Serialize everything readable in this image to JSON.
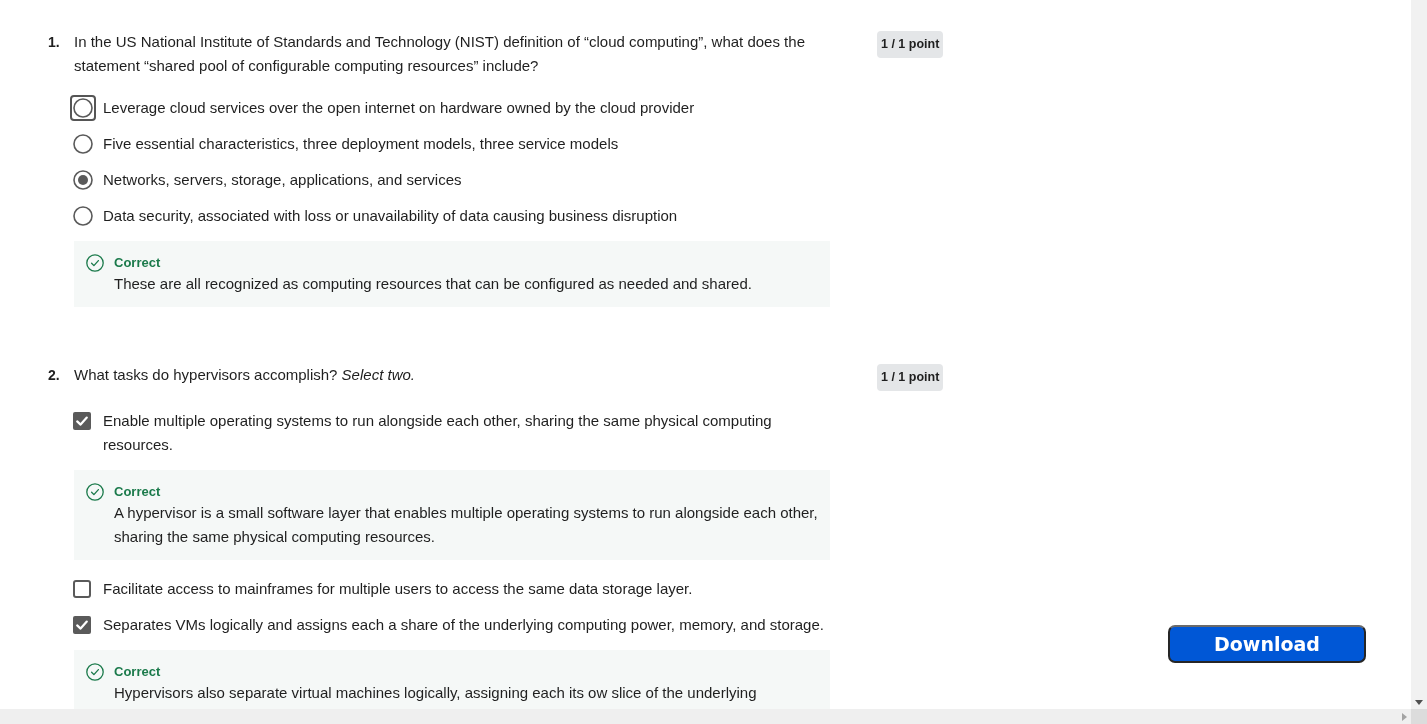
{
  "questions": [
    {
      "number": "1.",
      "prompt": "In the US National Institute of Standards and Technology (NIST) definition of “cloud computing”, what does the statement “shared pool of configurable computing resources” include?",
      "score": "1 / 1 point",
      "kind": "radio",
      "body": [
        {
          "kind": "option",
          "label": "Leverage cloud services over the open internet on hardware owned by the cloud provider",
          "selected": false,
          "focused": true
        },
        {
          "kind": "option",
          "label": "Five essential characteristics, three deployment models, three service models",
          "selected": false,
          "focused": false
        },
        {
          "kind": "option",
          "label": "Networks, servers, storage, applications, and services",
          "selected": true,
          "focused": false
        },
        {
          "kind": "option",
          "label": "Data security, associated with loss or unavailability of data causing business disruption",
          "selected": false,
          "focused": false
        },
        {
          "kind": "feedback",
          "status": "Correct",
          "text": "These are all recognized as computing resources that can be configured as needed and shared."
        }
      ]
    },
    {
      "number": "2.",
      "prompt": "What tasks do hypervisors accomplish? *Select two.*",
      "score": "1 / 1 point",
      "kind": "checkbox",
      "body": [
        {
          "kind": "option",
          "label": "Enable multiple operating systems to run alongside each other, sharing the same physical computing resources.",
          "checked": true,
          "focused": false
        },
        {
          "kind": "feedback",
          "status": "Correct",
          "text": "A hypervisor is a small software layer that enables multiple operating systems to run alongside each other, sharing the same physical computing resources."
        },
        {
          "kind": "option",
          "label": "Facilitate access to mainframes for multiple users to access the same data storage layer.",
          "checked": false,
          "focused": false
        },
        {
          "kind": "option",
          "label": "Separates VMs logically and assigns each a share of the underlying computing power, memory, and storage.",
          "checked": true,
          "focused": false
        },
        {
          "kind": "feedback",
          "status": "Correct",
          "text": "Hypervisors also separate virtual machines logically, assigning each its ow slice of the underlying"
        }
      ]
    }
  ],
  "download_button": {
    "label": "Download"
  }
}
